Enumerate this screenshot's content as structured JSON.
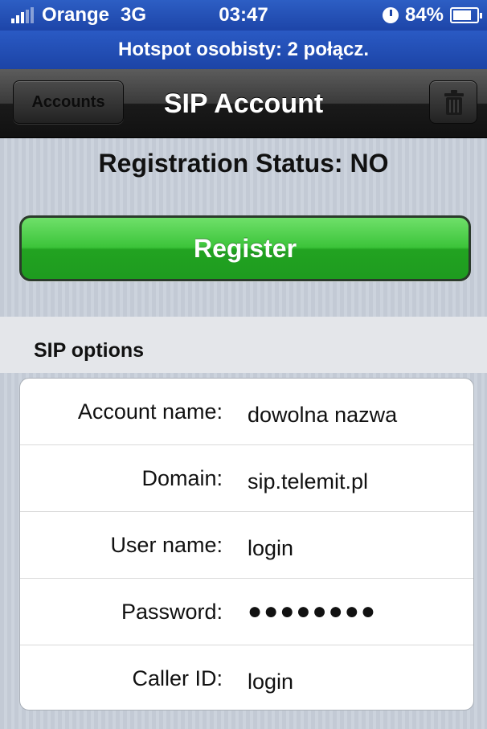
{
  "status_bar": {
    "carrier": "Orange",
    "network": "3G",
    "time": "03:47",
    "battery": "84%",
    "icons": [
      "signal-icon",
      "clock-icon",
      "battery-charging-icon"
    ]
  },
  "hotspot": {
    "text": "Hotspot osobisty: 2 połącz."
  },
  "nav": {
    "back_label": "Accounts",
    "title": "SIP Account",
    "trash_icon": "trash-icon"
  },
  "registration": {
    "status_text": "Registration Status: NO",
    "register_label": "Register",
    "button_color": "#2fb52e"
  },
  "sip_options": {
    "title": "SIP options",
    "rows": [
      {
        "label": "Account name:",
        "value": "dowolna nazwa"
      },
      {
        "label": "Domain:",
        "value": "sip.telemit.pl"
      },
      {
        "label": "User name:",
        "value": "login"
      },
      {
        "label": "Password:",
        "value": "●●●●●●●●"
      },
      {
        "label": "Caller ID:",
        "value": "login"
      }
    ]
  }
}
